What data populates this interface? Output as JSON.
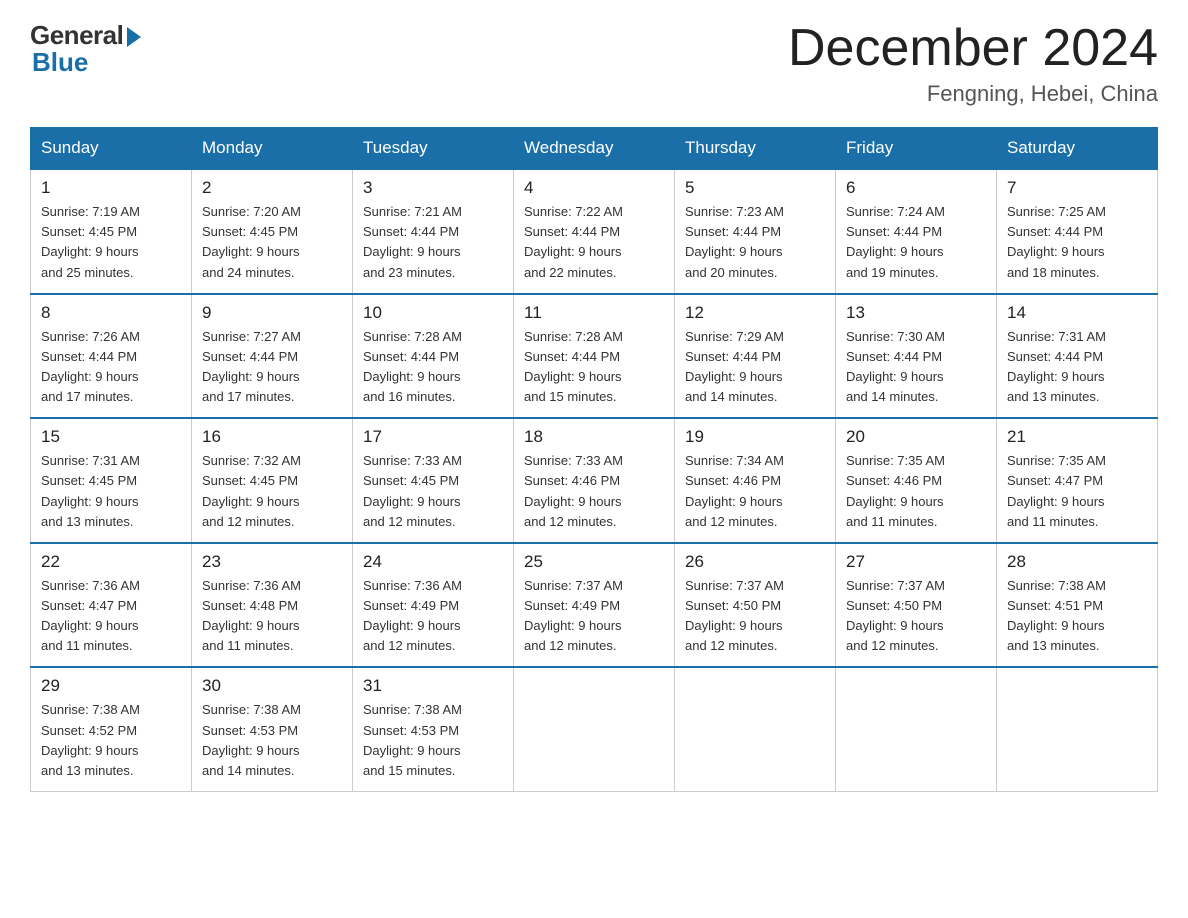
{
  "header": {
    "logo_general": "General",
    "logo_blue": "Blue",
    "month_title": "December 2024",
    "location": "Fengning, Hebei, China"
  },
  "columns": [
    "Sunday",
    "Monday",
    "Tuesday",
    "Wednesday",
    "Thursday",
    "Friday",
    "Saturday"
  ],
  "weeks": [
    [
      {
        "day": "1",
        "sunrise": "Sunrise: 7:19 AM",
        "sunset": "Sunset: 4:45 PM",
        "daylight": "Daylight: 9 hours",
        "daylight2": "and 25 minutes."
      },
      {
        "day": "2",
        "sunrise": "Sunrise: 7:20 AM",
        "sunset": "Sunset: 4:45 PM",
        "daylight": "Daylight: 9 hours",
        "daylight2": "and 24 minutes."
      },
      {
        "day": "3",
        "sunrise": "Sunrise: 7:21 AM",
        "sunset": "Sunset: 4:44 PM",
        "daylight": "Daylight: 9 hours",
        "daylight2": "and 23 minutes."
      },
      {
        "day": "4",
        "sunrise": "Sunrise: 7:22 AM",
        "sunset": "Sunset: 4:44 PM",
        "daylight": "Daylight: 9 hours",
        "daylight2": "and 22 minutes."
      },
      {
        "day": "5",
        "sunrise": "Sunrise: 7:23 AM",
        "sunset": "Sunset: 4:44 PM",
        "daylight": "Daylight: 9 hours",
        "daylight2": "and 20 minutes."
      },
      {
        "day": "6",
        "sunrise": "Sunrise: 7:24 AM",
        "sunset": "Sunset: 4:44 PM",
        "daylight": "Daylight: 9 hours",
        "daylight2": "and 19 minutes."
      },
      {
        "day": "7",
        "sunrise": "Sunrise: 7:25 AM",
        "sunset": "Sunset: 4:44 PM",
        "daylight": "Daylight: 9 hours",
        "daylight2": "and 18 minutes."
      }
    ],
    [
      {
        "day": "8",
        "sunrise": "Sunrise: 7:26 AM",
        "sunset": "Sunset: 4:44 PM",
        "daylight": "Daylight: 9 hours",
        "daylight2": "and 17 minutes."
      },
      {
        "day": "9",
        "sunrise": "Sunrise: 7:27 AM",
        "sunset": "Sunset: 4:44 PM",
        "daylight": "Daylight: 9 hours",
        "daylight2": "and 17 minutes."
      },
      {
        "day": "10",
        "sunrise": "Sunrise: 7:28 AM",
        "sunset": "Sunset: 4:44 PM",
        "daylight": "Daylight: 9 hours",
        "daylight2": "and 16 minutes."
      },
      {
        "day": "11",
        "sunrise": "Sunrise: 7:28 AM",
        "sunset": "Sunset: 4:44 PM",
        "daylight": "Daylight: 9 hours",
        "daylight2": "and 15 minutes."
      },
      {
        "day": "12",
        "sunrise": "Sunrise: 7:29 AM",
        "sunset": "Sunset: 4:44 PM",
        "daylight": "Daylight: 9 hours",
        "daylight2": "and 14 minutes."
      },
      {
        "day": "13",
        "sunrise": "Sunrise: 7:30 AM",
        "sunset": "Sunset: 4:44 PM",
        "daylight": "Daylight: 9 hours",
        "daylight2": "and 14 minutes."
      },
      {
        "day": "14",
        "sunrise": "Sunrise: 7:31 AM",
        "sunset": "Sunset: 4:44 PM",
        "daylight": "Daylight: 9 hours",
        "daylight2": "and 13 minutes."
      }
    ],
    [
      {
        "day": "15",
        "sunrise": "Sunrise: 7:31 AM",
        "sunset": "Sunset: 4:45 PM",
        "daylight": "Daylight: 9 hours",
        "daylight2": "and 13 minutes."
      },
      {
        "day": "16",
        "sunrise": "Sunrise: 7:32 AM",
        "sunset": "Sunset: 4:45 PM",
        "daylight": "Daylight: 9 hours",
        "daylight2": "and 12 minutes."
      },
      {
        "day": "17",
        "sunrise": "Sunrise: 7:33 AM",
        "sunset": "Sunset: 4:45 PM",
        "daylight": "Daylight: 9 hours",
        "daylight2": "and 12 minutes."
      },
      {
        "day": "18",
        "sunrise": "Sunrise: 7:33 AM",
        "sunset": "Sunset: 4:46 PM",
        "daylight": "Daylight: 9 hours",
        "daylight2": "and 12 minutes."
      },
      {
        "day": "19",
        "sunrise": "Sunrise: 7:34 AM",
        "sunset": "Sunset: 4:46 PM",
        "daylight": "Daylight: 9 hours",
        "daylight2": "and 12 minutes."
      },
      {
        "day": "20",
        "sunrise": "Sunrise: 7:35 AM",
        "sunset": "Sunset: 4:46 PM",
        "daylight": "Daylight: 9 hours",
        "daylight2": "and 11 minutes."
      },
      {
        "day": "21",
        "sunrise": "Sunrise: 7:35 AM",
        "sunset": "Sunset: 4:47 PM",
        "daylight": "Daylight: 9 hours",
        "daylight2": "and 11 minutes."
      }
    ],
    [
      {
        "day": "22",
        "sunrise": "Sunrise: 7:36 AM",
        "sunset": "Sunset: 4:47 PM",
        "daylight": "Daylight: 9 hours",
        "daylight2": "and 11 minutes."
      },
      {
        "day": "23",
        "sunrise": "Sunrise: 7:36 AM",
        "sunset": "Sunset: 4:48 PM",
        "daylight": "Daylight: 9 hours",
        "daylight2": "and 11 minutes."
      },
      {
        "day": "24",
        "sunrise": "Sunrise: 7:36 AM",
        "sunset": "Sunset: 4:49 PM",
        "daylight": "Daylight: 9 hours",
        "daylight2": "and 12 minutes."
      },
      {
        "day": "25",
        "sunrise": "Sunrise: 7:37 AM",
        "sunset": "Sunset: 4:49 PM",
        "daylight": "Daylight: 9 hours",
        "daylight2": "and 12 minutes."
      },
      {
        "day": "26",
        "sunrise": "Sunrise: 7:37 AM",
        "sunset": "Sunset: 4:50 PM",
        "daylight": "Daylight: 9 hours",
        "daylight2": "and 12 minutes."
      },
      {
        "day": "27",
        "sunrise": "Sunrise: 7:37 AM",
        "sunset": "Sunset: 4:50 PM",
        "daylight": "Daylight: 9 hours",
        "daylight2": "and 12 minutes."
      },
      {
        "day": "28",
        "sunrise": "Sunrise: 7:38 AM",
        "sunset": "Sunset: 4:51 PM",
        "daylight": "Daylight: 9 hours",
        "daylight2": "and 13 minutes."
      }
    ],
    [
      {
        "day": "29",
        "sunrise": "Sunrise: 7:38 AM",
        "sunset": "Sunset: 4:52 PM",
        "daylight": "Daylight: 9 hours",
        "daylight2": "and 13 minutes."
      },
      {
        "day": "30",
        "sunrise": "Sunrise: 7:38 AM",
        "sunset": "Sunset: 4:53 PM",
        "daylight": "Daylight: 9 hours",
        "daylight2": "and 14 minutes."
      },
      {
        "day": "31",
        "sunrise": "Sunrise: 7:38 AM",
        "sunset": "Sunset: 4:53 PM",
        "daylight": "Daylight: 9 hours",
        "daylight2": "and 15 minutes."
      },
      null,
      null,
      null,
      null
    ]
  ]
}
